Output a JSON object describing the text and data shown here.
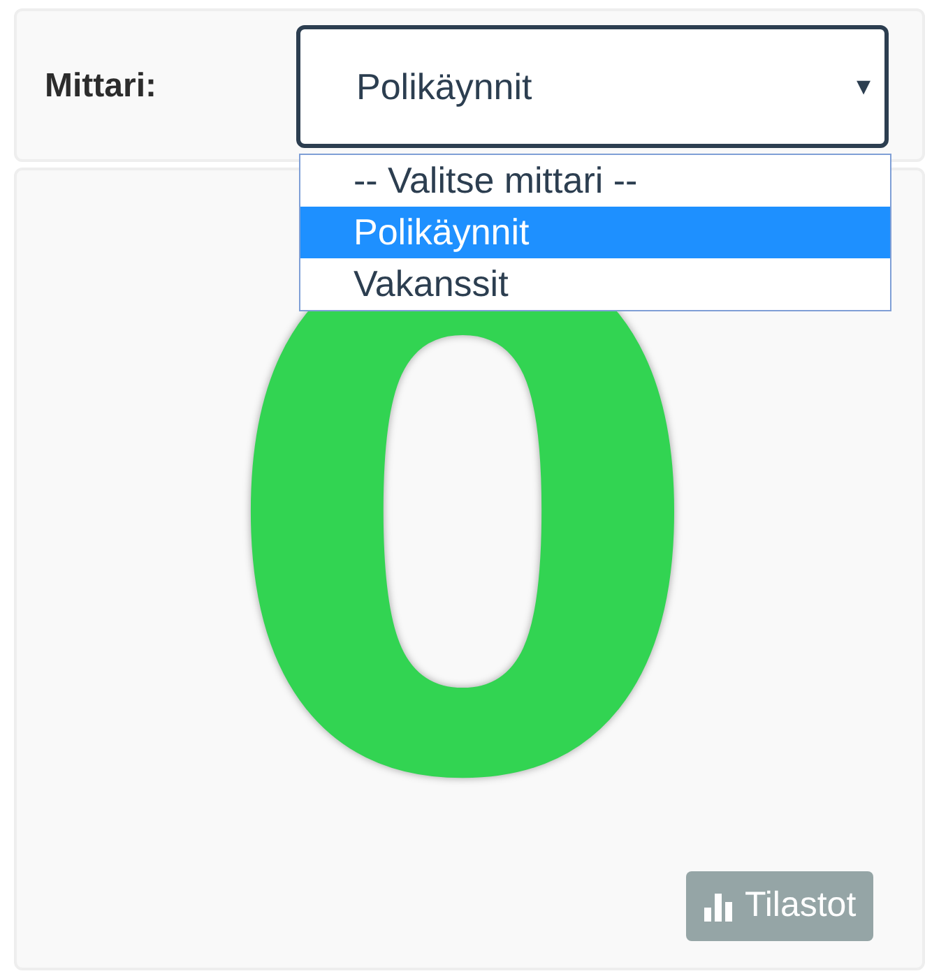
{
  "filter": {
    "label": "Mittari:",
    "value": "Polikäynnit",
    "caret": "▾",
    "expanded": true,
    "options": [
      {
        "label": "-- Valitse mittari --",
        "selected": false
      },
      {
        "label": "Polikäynnit",
        "selected": true
      },
      {
        "label": "Vakanssit",
        "selected": false
      }
    ]
  },
  "metric": {
    "value": "0",
    "color": "#32d452"
  },
  "buttons": [
    {
      "label": "Tilastot"
    }
  ]
}
